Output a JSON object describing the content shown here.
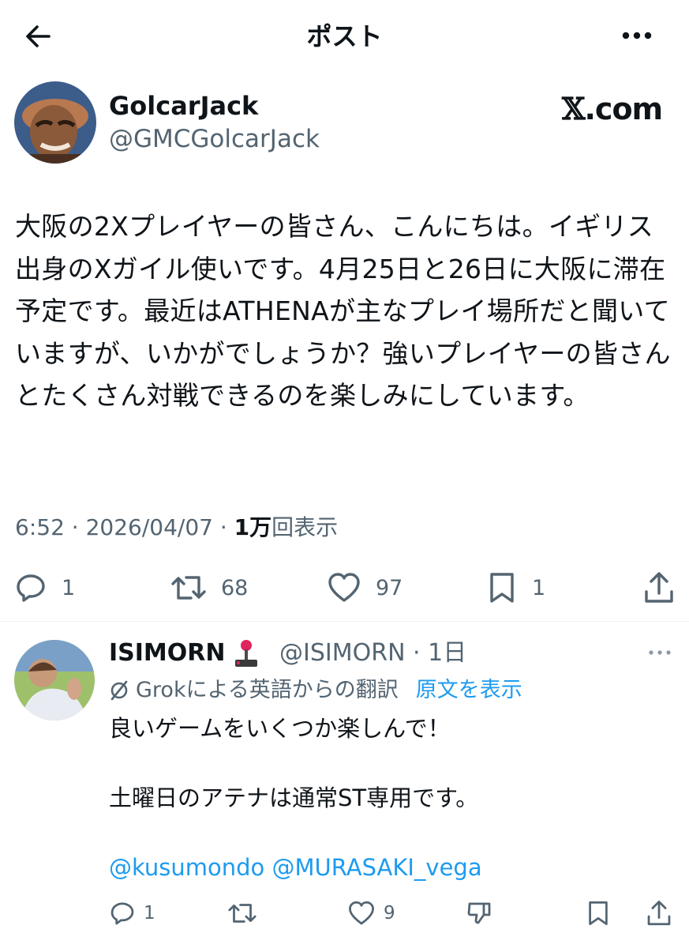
{
  "header": {
    "title": "ポスト",
    "back_icon": "arrow-left-icon",
    "more_icon": "more-horizontal-icon"
  },
  "post": {
    "display_name": "GolcarJack",
    "handle": "@GMCGolcarJack",
    "watermark_x": "𝕏",
    "watermark_rest": ".com",
    "body": "大阪の2Xプレイヤーの皆さん、こんにちは。イギリス出身のXガイル使いです。4月25日と26日に大阪に滞在予定です。最近はATHENAが主なプレイ場所だと聞いていますが、いかがでしょうか？強いプレイヤーの皆さんとたくさん対戦できるのを楽しみにしています。",
    "time": "6:52 · 2026/04/07 · ",
    "views_count": "1万",
    "views_label": "回表示",
    "actions": {
      "replies": "1",
      "reposts": "68",
      "likes": "97",
      "bookmarks": "1"
    }
  },
  "reply": {
    "display_name": "ISIMORN",
    "badge_icon": "joystick-icon",
    "handle_time": "@ISIMORN · 1日",
    "translation_note": "Grokによる英語からの翻訳",
    "show_original": "原文を表示",
    "body_line1": "良いゲームをいくつか楽しんで！",
    "body_line2": "土曜日のアテナは通常ST専用です。",
    "mention1": "@kusumondo",
    "mention2": "@MURASAKI_vega",
    "actions": {
      "replies": "1",
      "likes": "9"
    }
  },
  "colors": {
    "text": "#0f1419",
    "muted": "#536471",
    "link": "#1d9bf0",
    "divider": "#eff3f4"
  }
}
